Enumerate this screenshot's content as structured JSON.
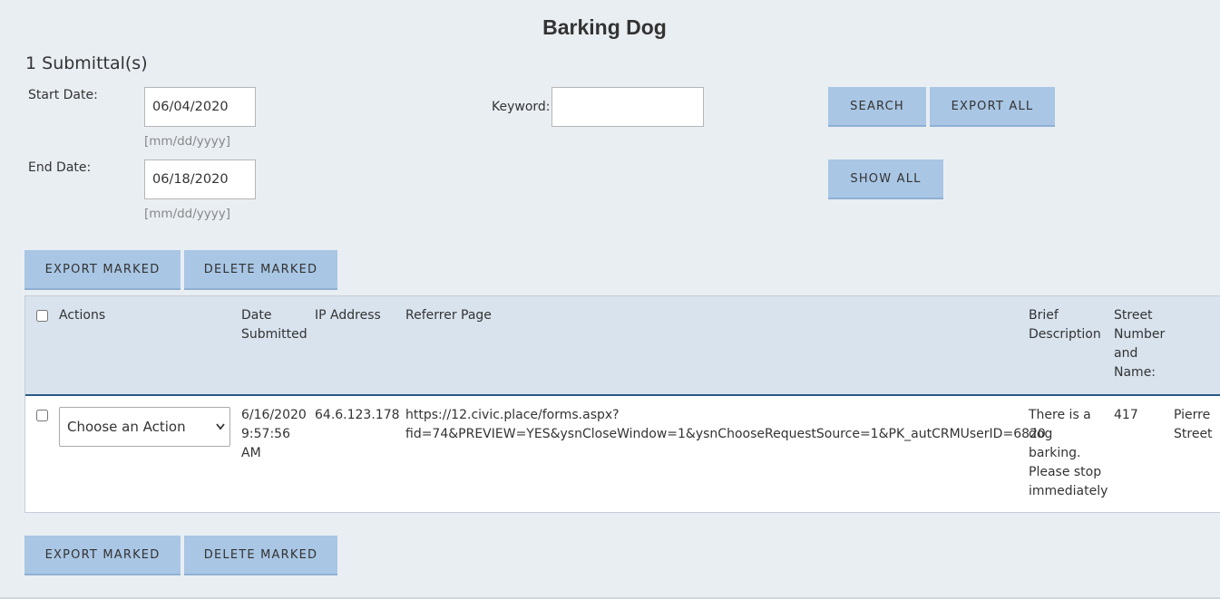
{
  "header": {
    "title": "Barking Dog",
    "submittal_count": "1 Submittal(s)"
  },
  "filters": {
    "start_date_label": "Start Date:",
    "start_date_value": "06/04/2020",
    "start_date_hint": "[mm/dd/yyyy]",
    "end_date_label": "End Date:",
    "end_date_value": "06/18/2020",
    "end_date_hint": "[mm/dd/yyyy]",
    "keyword_label": "Keyword:",
    "keyword_value": ""
  },
  "buttons": {
    "search": "SEARCH",
    "export_all": "EXPORT ALL",
    "show_all": "SHOW ALL",
    "export_marked": "EXPORT MARKED",
    "delete_marked": "DELETE MARKED"
  },
  "table": {
    "columns": {
      "actions": "Actions",
      "date_submitted_1": "Date",
      "date_submitted_2": "Submitted",
      "ip_address": "IP Address",
      "referrer_page": "Referrer Page",
      "brief_1": "Brief",
      "brief_2": "Description",
      "street_1": "Street",
      "street_2": "Number",
      "street_3": "and",
      "street_4": "Name:"
    },
    "row": {
      "action_selected": "Choose an Action",
      "date_1": "6/16/2020",
      "date_2": "9:57:56",
      "date_3": "AM",
      "ip": "64.6.123.178",
      "referrer_1": "https://12.civic.place/forms.aspx?",
      "referrer_2": "fid=74&PREVIEW=YES&ysnCloseWindow=1&ysnChooseRequestSource=1&PK_autCRMUserID=6820",
      "desc_1": "There is a",
      "desc_2": "dog",
      "desc_3": "barking.",
      "desc_4": "Please stop",
      "desc_5": "immediately",
      "street_number": "417",
      "street_name_1": "Pierre",
      "street_name_2": "Street"
    }
  }
}
